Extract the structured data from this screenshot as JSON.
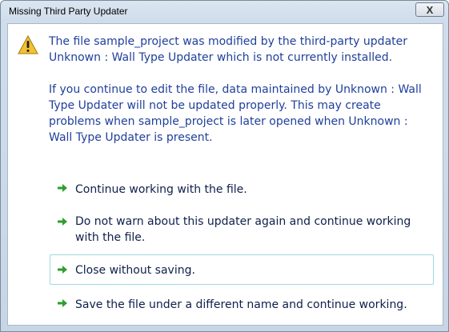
{
  "window": {
    "title": "Missing Third Party Updater",
    "close_label": "X"
  },
  "message": {
    "paragraph1": "The file sample_project was modified by the third-party updater Unknown : Wall Type Updater which is not currently installed.",
    "paragraph2": "If you continue to edit the file, data maintained by Unknown : Wall Type Updater will not be updated properly. This may create problems when sample_project  is later opened when Unknown : Wall Type Updater is present."
  },
  "options": [
    {
      "label": "Continue working with the file."
    },
    {
      "label": "Do not warn about this updater again and continue working with the file."
    },
    {
      "label": "Close without saving."
    },
    {
      "label": "Save the file under a different name and continue working."
    }
  ],
  "colors": {
    "message_text": "#1f3f9c",
    "option_text": "#0f1f4a",
    "arrow_green": "#2e9e2e",
    "warning_yellow": "#f2c230",
    "hover_border": "#9fd8e3"
  },
  "icons": {
    "warning": "warning-icon",
    "option_arrow": "green-arrow-icon",
    "close": "close-icon"
  }
}
